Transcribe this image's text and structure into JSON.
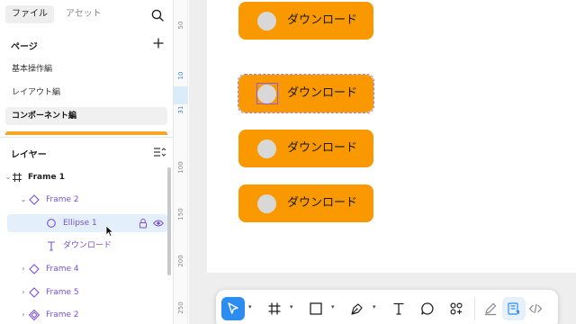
{
  "tabs": {
    "files": "ファイル",
    "assets": "アセット"
  },
  "pages": {
    "title": "ページ",
    "items": [
      {
        "label": "基本操作編",
        "active": false
      },
      {
        "label": "レイアウト編",
        "active": false
      },
      {
        "label": "コンポーネント編",
        "active": true
      }
    ]
  },
  "layers": {
    "title": "レイヤー",
    "items": [
      {
        "name": "Frame 1"
      },
      {
        "name": "Frame 2"
      },
      {
        "name": "Ellipse 1"
      },
      {
        "name": "ダウンロード"
      },
      {
        "name": "Frame 4"
      },
      {
        "name": "Frame 5"
      },
      {
        "name": "Frame 2"
      }
    ]
  },
  "ruler": {
    "ticks": [
      "50",
      "10",
      "31",
      "100",
      "150",
      "200",
      "250"
    ]
  },
  "canvas": {
    "buttons": [
      {
        "label": "ダウンロード"
      },
      {
        "label": "ダウンロード"
      },
      {
        "label": "ダウンロード"
      },
      {
        "label": "ダウンロード"
      }
    ]
  },
  "colors": {
    "accent": "#2d8cf0",
    "button": "#fa9800",
    "selection": "#8a5cf0",
    "component": "#7a4fd6"
  },
  "toolbar": {
    "tools": [
      "move-tool",
      "frame-tool",
      "shape-tool",
      "pen-tool",
      "text-tool",
      "comment-tool",
      "components-tool",
      "draw-mode",
      "design-mode",
      "dev-mode"
    ]
  }
}
